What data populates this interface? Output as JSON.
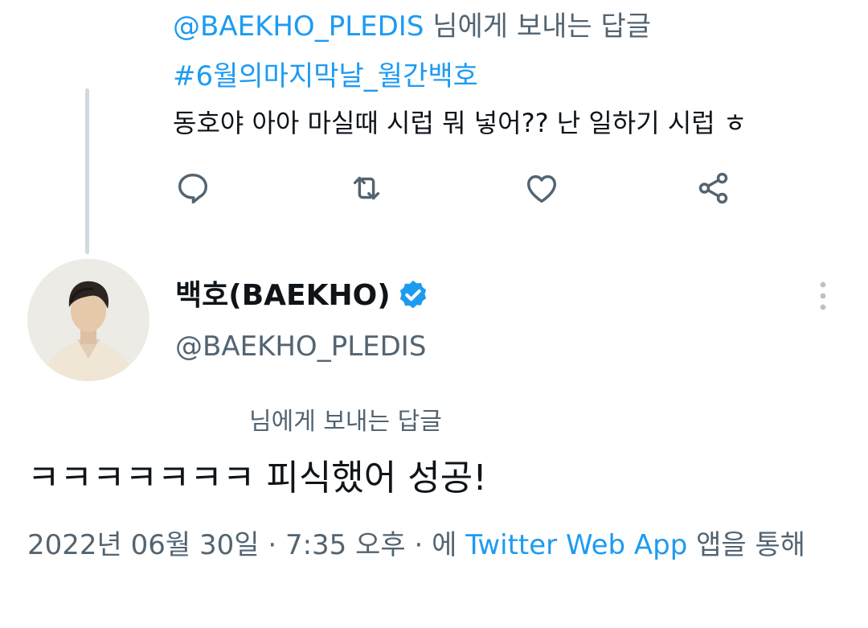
{
  "parent_tweet": {
    "reply_to_mention": "@BAEKHO_PLEDIS",
    "reply_to_suffix": " 님에게 보내는 답글",
    "hashtag": "#6월의마지막날_월간백호",
    "text": "동호야 아아 마실때 시럽 뭐 넣어?? 난 일하기 시럽 ㅎ",
    "actions": [
      {
        "name": "reply",
        "icon": "comment-icon"
      },
      {
        "name": "retweet",
        "icon": "retweet-icon"
      },
      {
        "name": "like",
        "icon": "heart-icon"
      },
      {
        "name": "share",
        "icon": "share-icon"
      }
    ]
  },
  "main_tweet": {
    "display_name": "백호(BAEKHO)",
    "handle": "@BAEKHO_PLEDIS",
    "verified": true,
    "reply_to_label": "님에게 보내는 답글",
    "text": "ㅋㅋㅋㅋㅋㅋㅋ 피식했어 성공!",
    "date": "2022년 06월 30일",
    "separator": " · ",
    "time": "7:35 오후",
    "via_prefix": "에 ",
    "source": "Twitter Web App",
    "via_suffix": " 앱을 통해"
  },
  "colors": {
    "link": "#1d9bf0",
    "secondary_text": "#536471",
    "primary_text": "#0f1419",
    "thread_line": "#cfd9de",
    "verified_badge": "#1d9bf0"
  }
}
